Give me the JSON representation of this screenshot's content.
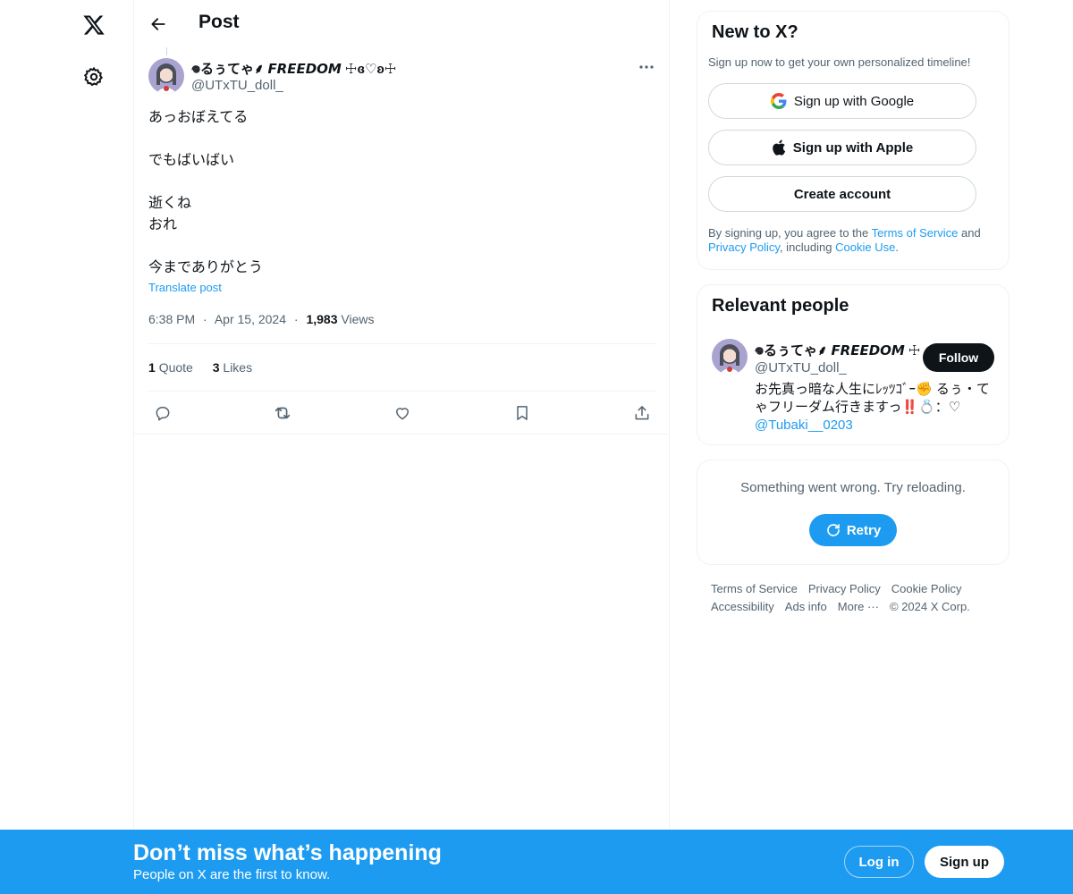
{
  "nav": {
    "logo_icon": "x-logo-icon",
    "settings_icon": "gear-icon"
  },
  "header": {
    "title": "Post",
    "back_icon": "arrow-left-icon"
  },
  "post": {
    "author_name": "​𖦹​​るぅてゃ⸙ 𝙁𝙍𝙀𝙀𝘿𝙊𝙈 ☩ɞ♡ʚ☩",
    "author_handle": "@UTxTU_doll_",
    "lines": [
      "あっおぼえてる",
      "でもばいばい",
      "逝くね",
      "おれ",
      "今までありがとう"
    ],
    "translate_label": "Translate post",
    "time": "6:38 PM",
    "dot": "·",
    "date": "Apr 15, 2024",
    "views_count": "1,983",
    "views_label": "Views",
    "quote_count": "1",
    "quote_label": "Quote",
    "likes_count": "3",
    "likes_label": "Likes"
  },
  "signup_card": {
    "title": "New to X?",
    "subtitle": "Sign up now to get your own personalized timeline!",
    "google_label": "Sign up with Google",
    "apple_label": "Sign up with Apple",
    "create_label": "Create account",
    "legal_prefix": "By signing up, you agree to the ",
    "terms_link": "Terms of Service",
    "legal_and": " and",
    "privacy_link": "Privacy Policy",
    "legal_including": ", including ",
    "cookie_link": "Cookie Use",
    "legal_end": "."
  },
  "people_card": {
    "title": "Relevant people",
    "name": "​𖦹​​るぅてゃ⸙ 𝙁𝙍𝙀𝙀𝘿𝙊𝙈 ☩",
    "handle": "@UTxTU_doll_",
    "follow_label": "Follow",
    "bio_text": "お先真っ暗な人生にﾚｯﾂｺﾞｰ✊ るぅ・てゃフリーダム行きますっ‼️💍：♡ ",
    "bio_mention": "@Tubaki__0203"
  },
  "error_card": {
    "message": "Something went wrong. Try reloading.",
    "retry_label": "Retry"
  },
  "footer": {
    "terms": "Terms of Service",
    "privacy": "Privacy Policy",
    "cookie": "Cookie Policy",
    "accessibility": "Accessibility",
    "ads": "Ads info",
    "more": "More ···",
    "copyright": "© 2024 X Corp."
  },
  "banner": {
    "title": "Don’t miss what’s happening",
    "subtitle": "People on X are the first to know.",
    "login_label": "Log in",
    "signup_label": "Sign up"
  },
  "colors": {
    "accent": "#1d9bf0",
    "text": "#0f1419",
    "muted": "#536471",
    "border": "#eff3f4"
  }
}
